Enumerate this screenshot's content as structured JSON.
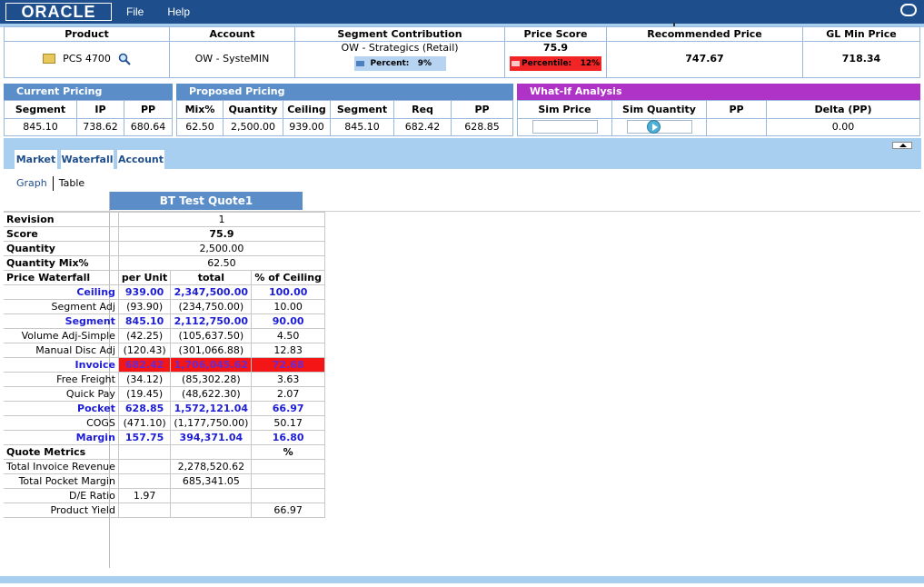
{
  "app": {
    "logo": "ORACLE",
    "menu": [
      "File",
      "Help"
    ]
  },
  "summary": {
    "headers": [
      "Product",
      "Account",
      "Segment Contribution",
      "Price Score",
      "Recommended Price",
      "GL Min Price"
    ],
    "product": "PCS 4700",
    "account": "OW - SysteMIN",
    "segment": "OW - Strategics (Retail)",
    "percent_label": "Percent:",
    "percent_value": "9%",
    "price_score": "75.9",
    "percentile_label": "Percentile:",
    "percentile_value": "12%",
    "recommended_price": "747.67",
    "gl_min_price": "718.34"
  },
  "current_pricing": {
    "title": "Current Pricing",
    "headers": [
      "Segment",
      "IP",
      "PP"
    ],
    "values": [
      "845.10",
      "738.62",
      "680.64"
    ]
  },
  "proposed_pricing": {
    "title": "Proposed Pricing",
    "headers": [
      "Mix%",
      "Quantity",
      "Ceiling",
      "Segment",
      "Req",
      "PP"
    ],
    "values": [
      "62.50",
      "2,500.00",
      "939.00",
      "845.10",
      "682.42",
      "628.85"
    ]
  },
  "whatif": {
    "title": "What-If Analysis",
    "headers": [
      "Sim Price",
      "Sim Quantity",
      "PP",
      "Delta (PP)"
    ],
    "delta": "0.00",
    "sim_price": "",
    "sim_quantity": ""
  },
  "tabs": [
    "Market",
    "Waterfall",
    "Account"
  ],
  "subnav": [
    "Graph",
    "Table"
  ],
  "quote_title": "BT Test Quote1",
  "top_rows": [
    {
      "label": "Revision",
      "value": "1",
      "bold": false
    },
    {
      "label": "Score",
      "value": "75.9",
      "bold": true
    },
    {
      "label": "Quantity",
      "value": "2,500.00",
      "bold": false
    },
    {
      "label": "Quantity Mix%",
      "value": "62.50",
      "bold": false
    }
  ],
  "waterfall_header": [
    "Price Waterfall",
    "per Unit",
    "total",
    "% of Ceiling"
  ],
  "waterfall_rows": [
    {
      "label": "Ceiling",
      "unit": "939.00",
      "total": "2,347,500.00",
      "pct": "100.00",
      "style": "blue"
    },
    {
      "label": "Segment Adj",
      "unit": "(93.90)",
      "total": "(234,750.00)",
      "pct": "10.00",
      "style": ""
    },
    {
      "label": "Segment",
      "unit": "845.10",
      "total": "2,112,750.00",
      "pct": "90.00",
      "style": "blue"
    },
    {
      "label": "Volume Adj-Simple",
      "unit": "(42.25)",
      "total": "(105,637.50)",
      "pct": "4.50",
      "style": ""
    },
    {
      "label": "Manual Disc Adj",
      "unit": "(120.43)",
      "total": "(301,066.88)",
      "pct": "12.83",
      "style": ""
    },
    {
      "label": "Invoice",
      "unit": "682.42",
      "total": "1,706,045.62",
      "pct": "72.68",
      "style": "blue red"
    },
    {
      "label": "Free Freight",
      "unit": "(34.12)",
      "total": "(85,302.28)",
      "pct": "3.63",
      "style": ""
    },
    {
      "label": "Quick Pay",
      "unit": "(19.45)",
      "total": "(48,622.30)",
      "pct": "2.07",
      "style": ""
    },
    {
      "label": "Pocket",
      "unit": "628.85",
      "total": "1,572,121.04",
      "pct": "66.97",
      "style": "blue"
    },
    {
      "label": "COGS",
      "unit": "(471.10)",
      "total": "(1,177,750.00)",
      "pct": "50.17",
      "style": ""
    },
    {
      "label": "Margin",
      "unit": "157.75",
      "total": "394,371.04",
      "pct": "16.80",
      "style": "blue"
    }
  ],
  "metrics_header": [
    "Quote Metrics",
    "",
    "",
    "%"
  ],
  "metrics_rows": [
    {
      "label": "Total Invoice Revenue",
      "unit": "",
      "total": "2,278,520.62",
      "pct": ""
    },
    {
      "label": "Total Pocket Margin",
      "unit": "",
      "total": "685,341.05",
      "pct": ""
    },
    {
      "label": "D/E Ratio",
      "unit": "1.97",
      "total": "",
      "pct": ""
    },
    {
      "label": "Product Yield",
      "unit": "",
      "total": "",
      "pct": "66.97"
    }
  ]
}
